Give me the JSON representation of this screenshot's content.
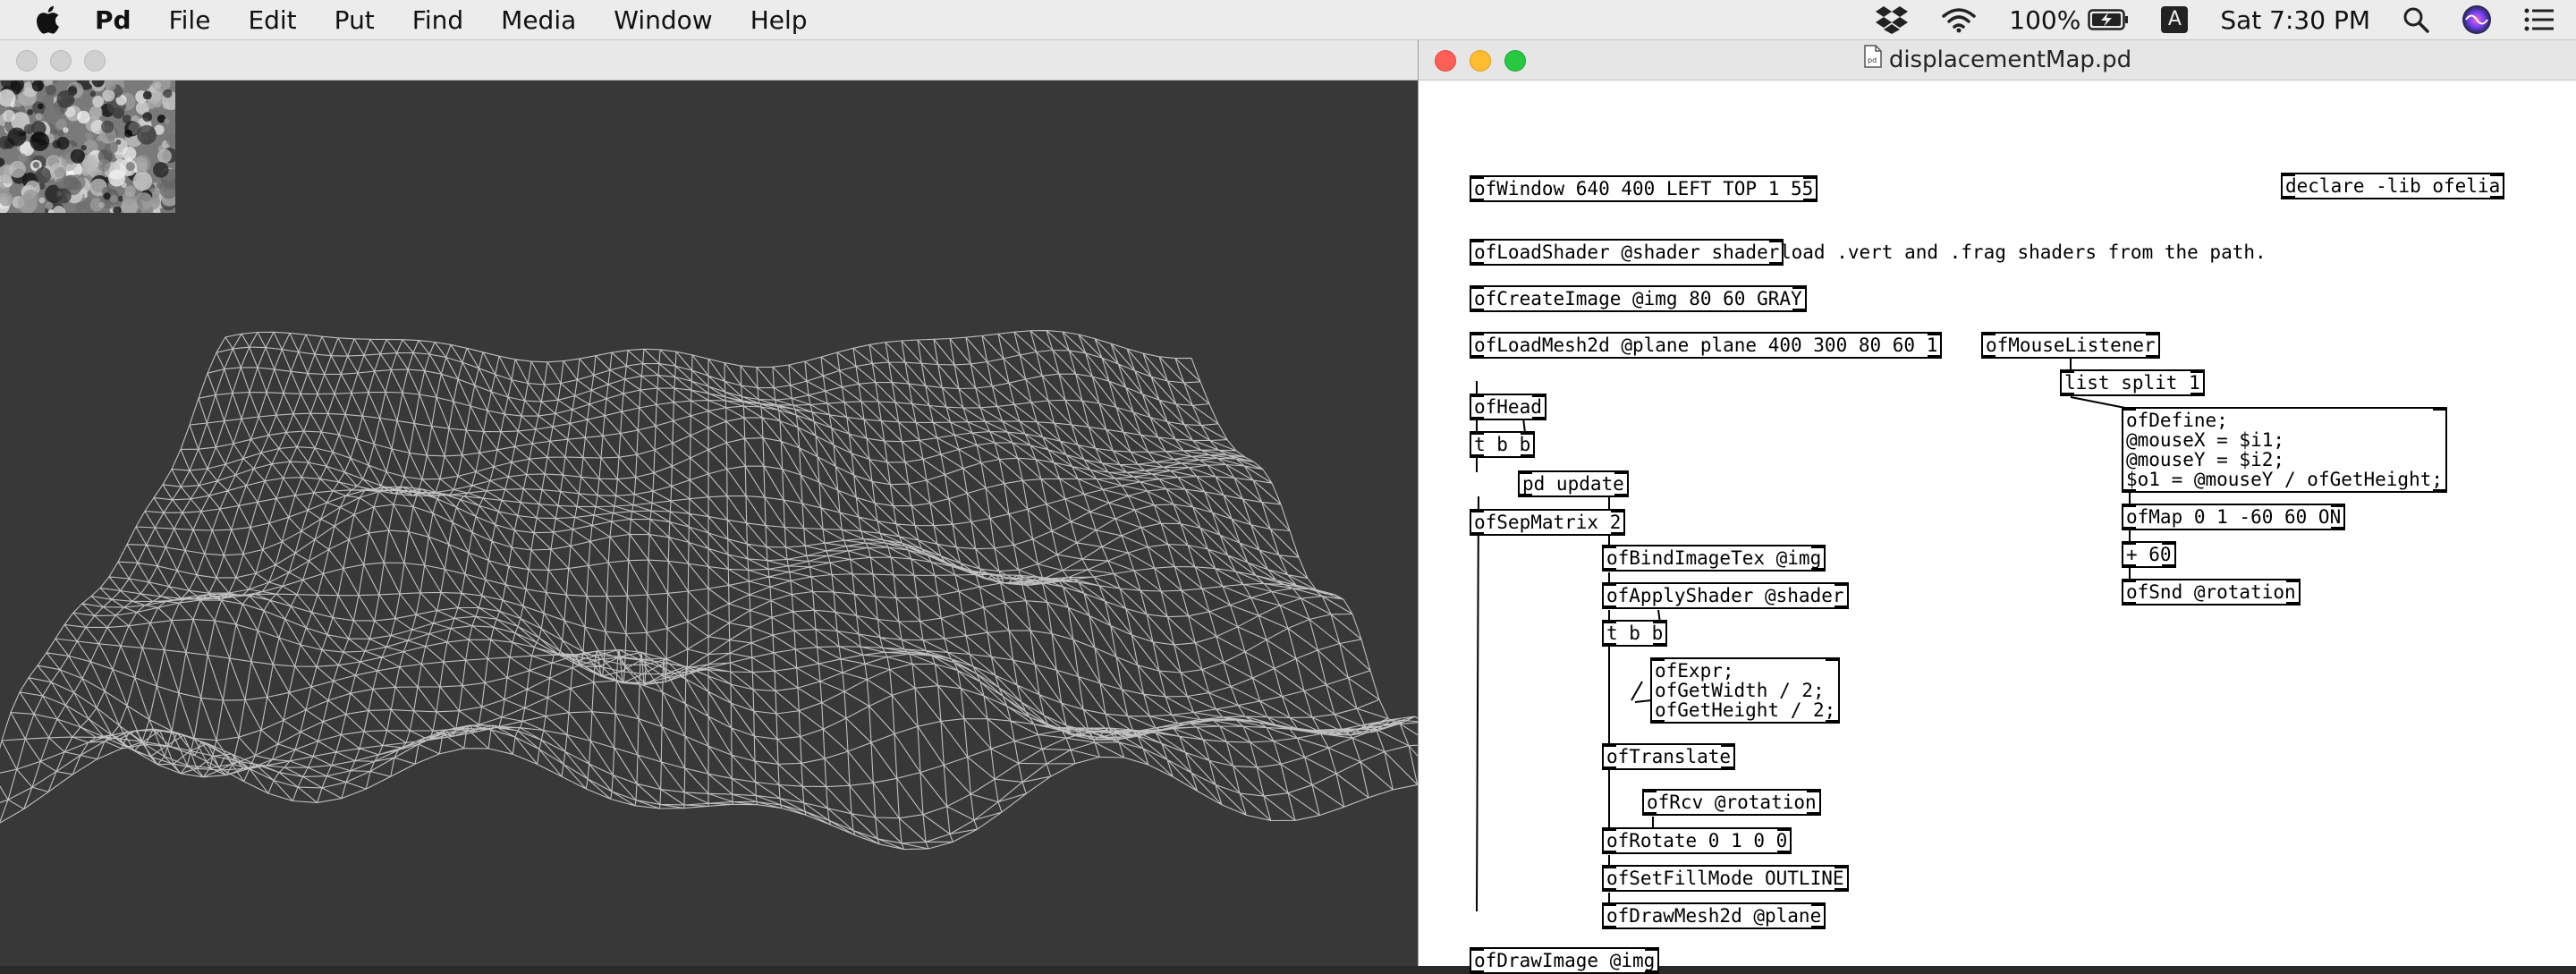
{
  "menubar": {
    "app": "Pd",
    "items": [
      "File",
      "Edit",
      "Put",
      "Find",
      "Media",
      "Window",
      "Help"
    ],
    "battery": "100%",
    "input_source": "A",
    "clock": "Sat 7:30 PM",
    "icons": [
      "apple-icon",
      "dropbox-icon",
      "wifi-icon",
      "battery-icon",
      "input-source-icon",
      "spotlight-icon",
      "siri-icon",
      "notification-center-icon"
    ]
  },
  "render_window": {
    "title": ""
  },
  "patch_window": {
    "title": "displacementMap.pd",
    "objects": [
      {
        "text": "ofWindow 640 400 LEFT TOP 1 55"
      },
      {
        "text": "declare -lib ofelia"
      },
      {
        "text": "ofLoadShader @shader shader"
      },
      {
        "text": "ofCreateImage @img 80 60 GRAY"
      },
      {
        "text": "ofLoadMesh2d @plane plane 400 300 80 60 1"
      },
      {
        "text": "ofMouseListener"
      },
      {
        "text": "list split 1"
      },
      {
        "text": "ofHead"
      },
      {
        "text": "t b b"
      },
      {
        "text": "pd update"
      },
      {
        "text": "ofSepMatrix 2"
      },
      {
        "text": "ofDefine;\n@mouseX = $i1;\n@mouseY = $i2;\n$o1 = @mouseY / ofGetHeight;"
      },
      {
        "text": "ofMap 0 1 -60 60 ON"
      },
      {
        "text": "+ 60"
      },
      {
        "text": "ofSnd @rotation"
      },
      {
        "text": "ofBindImageTex @img"
      },
      {
        "text": "ofApplyShader @shader"
      },
      {
        "text": "t b b"
      },
      {
        "text": "ofExpr;\nofGetWidth / 2;\nofGetHeight / 2;"
      },
      {
        "text": "ofTranslate"
      },
      {
        "text": "ofRcv @rotation"
      },
      {
        "text": "ofRotate 0 1 0 0"
      },
      {
        "text": "ofSetFillMode OUTLINE"
      },
      {
        "text": "ofDrawMesh2d @plane"
      },
      {
        "text": "ofDrawImage @img"
      }
    ],
    "comments": [
      {
        "text": "load .vert and .frag shaders from the path."
      }
    ]
  },
  "colors": {
    "render_bg": "#383838",
    "close": "#fd5f57",
    "minimize": "#febc2e",
    "zoom": "#28c840",
    "inactive_light": "#d0d0d0"
  }
}
